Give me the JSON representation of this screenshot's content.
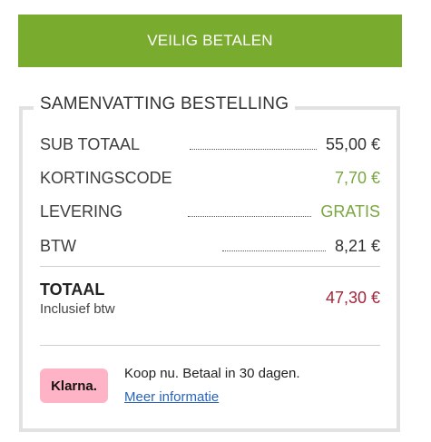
{
  "pay_button": {
    "label": "VEILIG BETALEN"
  },
  "summary": {
    "title": "SAMENVATTING BESTELLING",
    "rows": [
      {
        "label": "SUB TOTAAL",
        "value": "55,00 €"
      },
      {
        "label": "KORTINGSCODE",
        "value": "7,70 €"
      },
      {
        "label": "LEVERING",
        "value": "GRATIS"
      },
      {
        "label": "BTW",
        "value": "8,21 €"
      }
    ],
    "total": {
      "label": "TOTAAL",
      "sublabel": "Inclusief btw",
      "value": "47,30 €"
    }
  },
  "klarna": {
    "logo_text": "Klarna.",
    "text": "Koop nu. Betaal in 30 dagen.",
    "link": "Meer informatie"
  },
  "colors": {
    "button": "#79ab2e",
    "discount": "#7aa640",
    "total": "#a32638",
    "klarna_badge": "#ffb3c7",
    "link": "#2a63b8"
  }
}
